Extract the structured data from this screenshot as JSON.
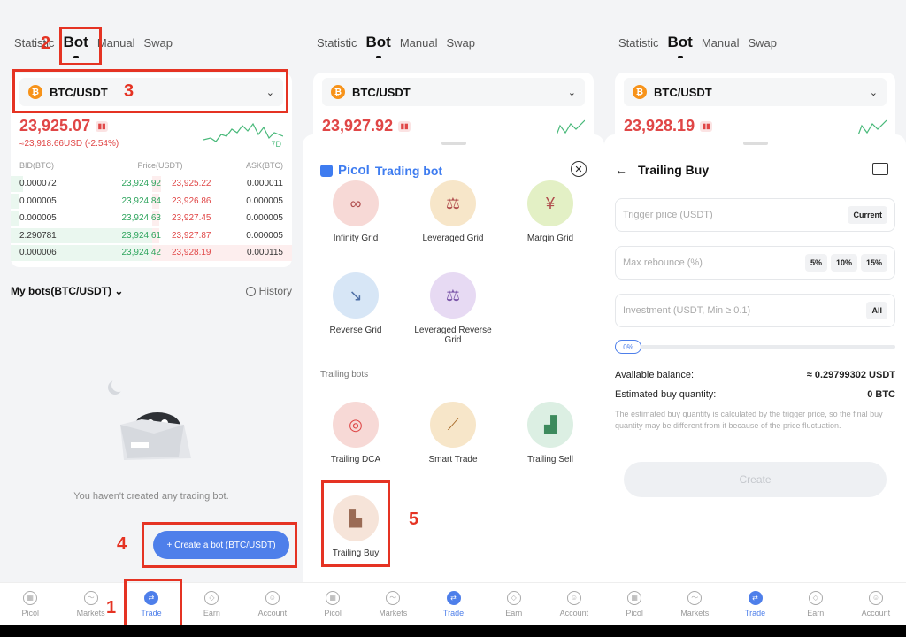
{
  "tabs": [
    {
      "label": "Statistic"
    },
    {
      "label": "Bot"
    },
    {
      "label": "Manual"
    },
    {
      "label": "Swap"
    }
  ],
  "market": {
    "pair": "BTC/USDT",
    "coin_glyph": "₿",
    "panels_price": [
      "23,925.07",
      "23,927.92",
      "23,928.19"
    ],
    "change": "≈23,918.66USD (-2.54%)",
    "spark_label": "7D",
    "ob_headers": [
      "BID(BTC)",
      "Price(USDT)",
      "ASK(BTC)"
    ],
    "order_book": [
      {
        "bid": "0.000072",
        "bid_price": "23,924.92",
        "ask_price": "23,925.22",
        "ask": "0.000011"
      },
      {
        "bid": "0.000005",
        "bid_price": "23,924.84",
        "ask_price": "23,926.86",
        "ask": "0.000005"
      },
      {
        "bid": "0.000005",
        "bid_price": "23,924.63",
        "ask_price": "23,927.45",
        "ask": "0.000005"
      },
      {
        "bid": "2.290781",
        "bid_price": "23,924.61",
        "ask_price": "23,927.87",
        "ask": "0.000005"
      },
      {
        "bid": "0.000006",
        "bid_price": "23,924.42",
        "ask_price": "23,928.19",
        "ask": "0.000115"
      }
    ]
  },
  "mybots": {
    "title": "My bots(BTC/USDT)",
    "history": "History",
    "empty": "You haven't created any trading bot.",
    "create": "+ Create a bot (BTC/USDT)"
  },
  "bottom_nav": [
    {
      "label": "Picol"
    },
    {
      "label": "Markets"
    },
    {
      "label": "Trade"
    },
    {
      "label": "Earn"
    },
    {
      "label": "Account"
    }
  ],
  "annotations": [
    "1",
    "2",
    "3",
    "4",
    "5"
  ],
  "bot_sheet": {
    "brand": "Picol",
    "title": "Trading bot",
    "grid_bots": [
      {
        "label": "Infinity Grid",
        "glyph": "∞",
        "color": "#f7d9d6"
      },
      {
        "label": "Leveraged Grid",
        "glyph": "⚖",
        "color": "#f7e6c9"
      },
      {
        "label": "Margin Grid",
        "glyph": "¥",
        "color": "#e3f0c5"
      },
      {
        "label": "Reverse Grid",
        "glyph": "↘",
        "color": "#d7e6f6"
      },
      {
        "label": "Leveraged Reverse Grid",
        "glyph": "⚖",
        "color": "#e7daf3"
      }
    ],
    "trailing_label": "Trailing bots",
    "trailing_bots": [
      {
        "label": "Trailing DCA",
        "glyph": "◎",
        "color": "#f7d9d6"
      },
      {
        "label": "Smart Trade",
        "glyph": "⟋",
        "color": "#f7e6c9"
      },
      {
        "label": "Trailing Sell",
        "glyph": "▟",
        "color": "#dcefe3"
      },
      {
        "label": "Trailing Buy",
        "glyph": "▙",
        "color": "#f6e4d9"
      }
    ]
  },
  "trailing_buy": {
    "title": "Trailing Buy",
    "trigger_ph": "Trigger price (USDT)",
    "trigger_chip": "Current",
    "rebounce_ph": "Max rebounce (%)",
    "rebounce_chips": [
      "5%",
      "10%",
      "15%"
    ],
    "investment_ph": "Investment (USDT, Min ≥ 0.1)",
    "investment_chip": "All",
    "slider": "0%",
    "balance_label": "Available balance:",
    "balance_value": "≈ 0.29799302 USDT",
    "qty_label": "Estimated buy quantity:",
    "qty_value": "0 BTC",
    "note": "The estimated buy quantity is calculated by the trigger price, so the final buy quantity may be different from it because of the price fluctuation.",
    "create": "Create"
  }
}
